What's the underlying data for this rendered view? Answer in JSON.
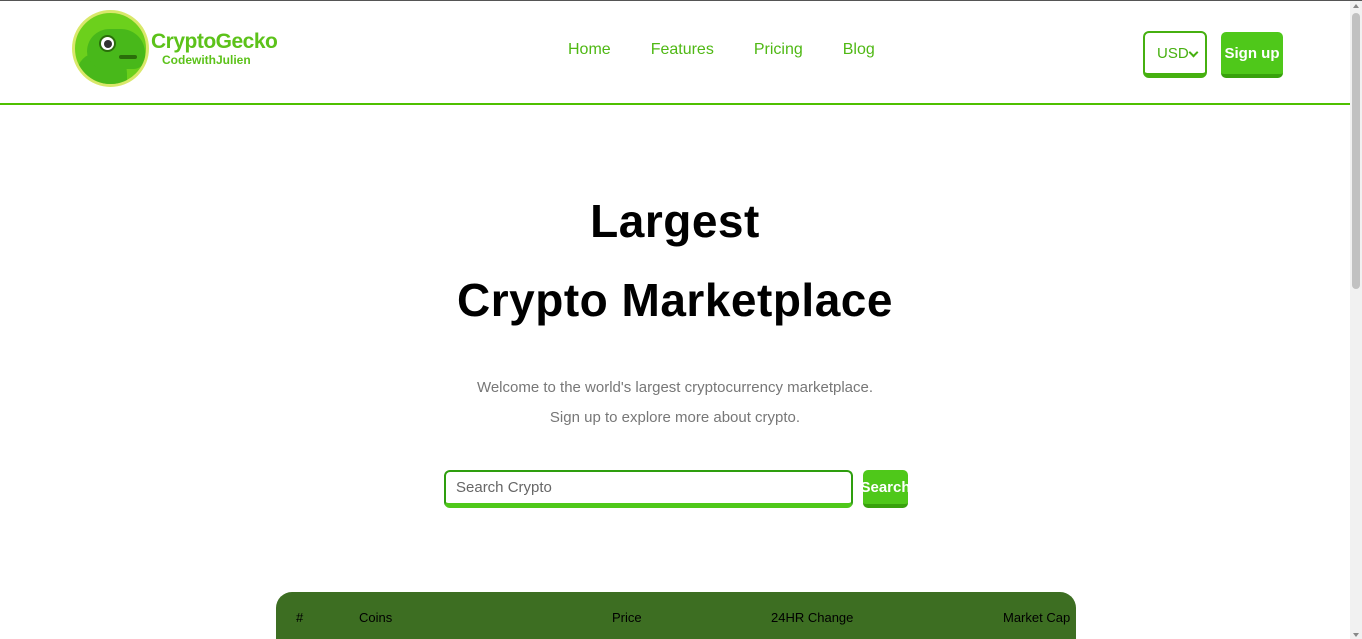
{
  "brand": {
    "title": "CryptoGecko",
    "subtitle": "CodewithJulien",
    "logo_icon": "gecko-logo-icon"
  },
  "nav": {
    "items": [
      {
        "label": "Home"
      },
      {
        "label": "Features"
      },
      {
        "label": "Pricing"
      },
      {
        "label": "Blog"
      }
    ]
  },
  "currency": {
    "selected": "USD",
    "icon": "chevron-down-icon"
  },
  "signup": {
    "label": "Sign up"
  },
  "hero": {
    "line1": "Largest",
    "line2": "Crypto Marketplace",
    "description": "Welcome to the world's largest cryptocurrency marketplace. Sign up to explore more about crypto."
  },
  "search": {
    "placeholder": "Search Crypto",
    "value": "",
    "button_label": "Search"
  },
  "table": {
    "columns": [
      "#",
      "Coins",
      "Price",
      "24HR Change",
      "Market Cap"
    ]
  },
  "colors": {
    "accent": "#4fc81a",
    "accent_dark": "#38a10c",
    "table_header_bg": "#3d6e22",
    "text_muted": "#777777"
  }
}
